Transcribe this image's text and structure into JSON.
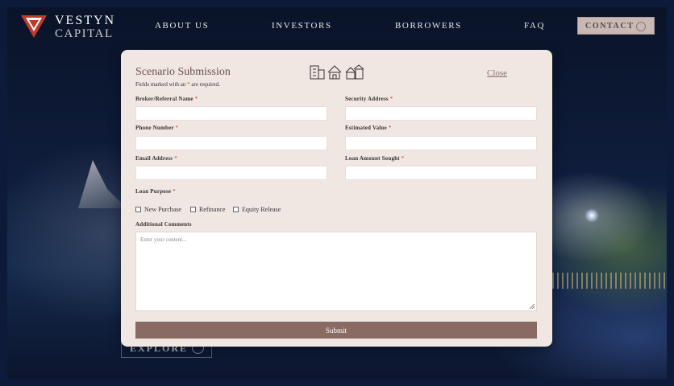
{
  "header": {
    "brand_line1": "VESTYN",
    "brand_line2": "CAPITAL",
    "nav": [
      "ABOUT US",
      "INVESTORS",
      "BORROWERS",
      "FAQ"
    ],
    "contact_label": "CONTACT"
  },
  "hero": {
    "explore_label": "EXPLORE"
  },
  "modal": {
    "title": "Scenario Submission",
    "required_note_pre": "Fields marked with an ",
    "required_note_ast": "*",
    "required_note_post": " are required.",
    "close_label": "Close",
    "icons": [
      "building-icon",
      "house-icon",
      "houses-icon"
    ],
    "fields": {
      "broker_name": "Broker/Referral Name",
      "security_address": "Security Address",
      "phone": "Phone Number",
      "estimated_value": "Estimated Value",
      "email": "Email Address",
      "loan_amount": "Loan Amount Sought",
      "loan_purpose": "Loan Purpose",
      "comments": "Additional Comments"
    },
    "required_marker": "*",
    "loan_purpose_options": [
      "New Purchase",
      "Refinance",
      "Equity Release"
    ],
    "comments_placeholder": "Enter your content...",
    "submit_label": "Submit"
  },
  "colors": {
    "accent": "#8a6b64",
    "brand_red": "#c0392b"
  }
}
